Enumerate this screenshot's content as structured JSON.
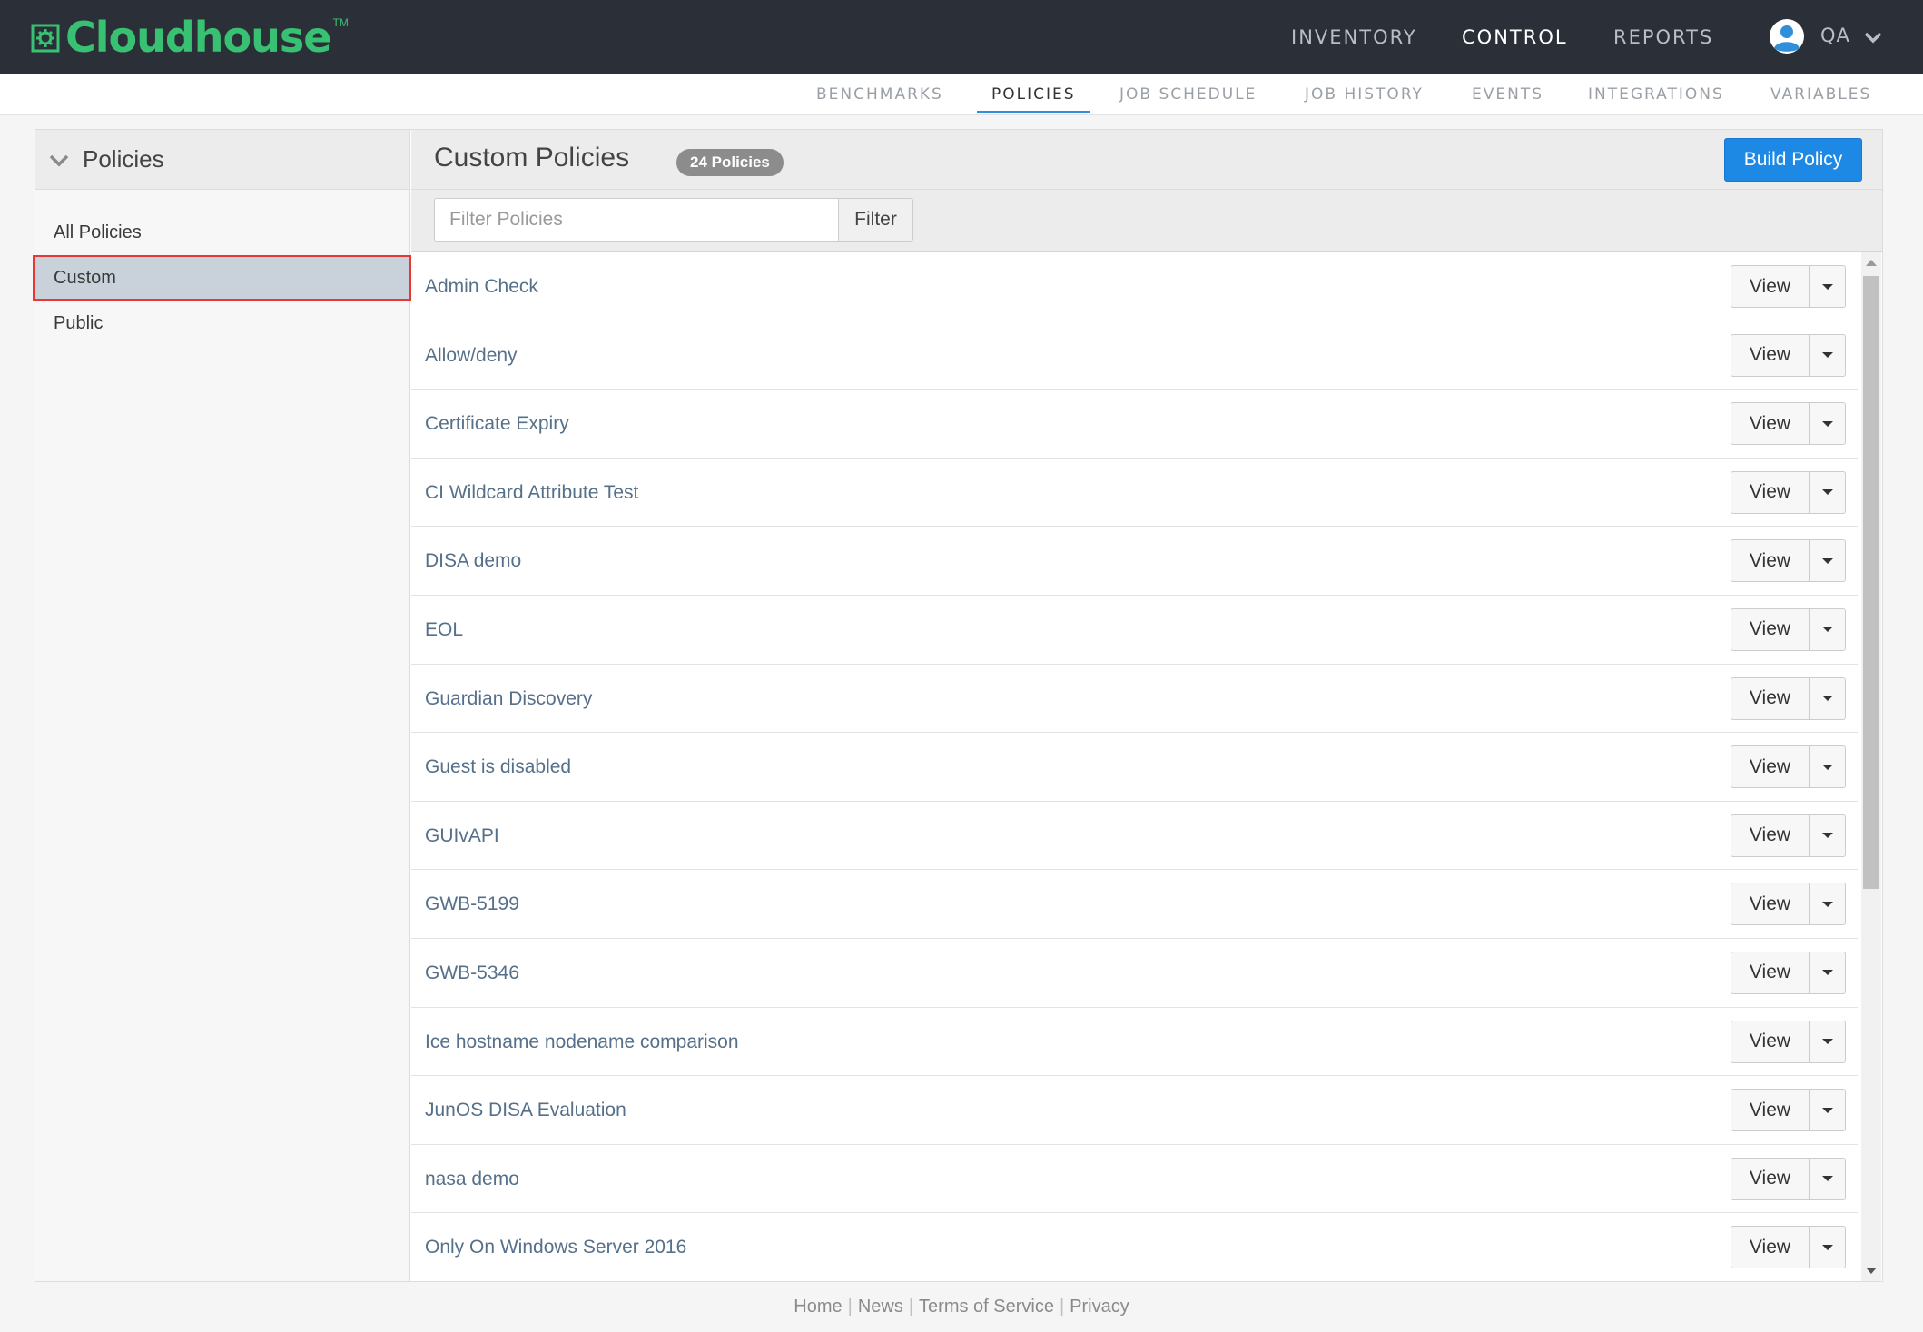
{
  "brand": {
    "name": "Cloudhouse",
    "trademark": "TM",
    "color": "#38c172"
  },
  "main_nav": {
    "items": [
      {
        "label": "INVENTORY",
        "active": false
      },
      {
        "label": "CONTROL",
        "active": true
      },
      {
        "label": "REPORTS",
        "active": false
      }
    ],
    "user": {
      "name": "QA",
      "icon": "user-avatar-icon"
    }
  },
  "sub_nav": {
    "items": [
      {
        "label": "BENCHMARKS",
        "active": false
      },
      {
        "label": "POLICIES",
        "active": true
      },
      {
        "label": "JOB SCHEDULE",
        "active": false
      },
      {
        "label": "JOB HISTORY",
        "active": false
      },
      {
        "label": "EVENTS",
        "active": false
      },
      {
        "label": "INTEGRATIONS",
        "active": false
      },
      {
        "label": "VARIABLES",
        "active": false
      }
    ],
    "accent_color": "#2f8fd8"
  },
  "sidebar": {
    "title": "Policies",
    "items": [
      {
        "label": "All Policies",
        "selected": false
      },
      {
        "label": "Custom",
        "selected": true
      },
      {
        "label": "Public",
        "selected": false
      }
    ]
  },
  "content": {
    "title": "Custom Policies",
    "count_badge": "24 Policies",
    "build_button": "Build Policy",
    "filter": {
      "placeholder": "Filter Policies",
      "value": "",
      "button": "Filter"
    },
    "row_button": "View",
    "policies": [
      "Admin Check",
      "Allow/deny",
      "Certificate Expiry",
      "CI Wildcard Attribute Test",
      "DISA demo",
      "EOL",
      "Guardian Discovery",
      "Guest is disabled",
      "GUIvAPI",
      "GWB-5199",
      "GWB-5346",
      "Ice hostname nodename comparison",
      "JunOS DISA Evaluation",
      "nasa demo",
      "Only On Windows Server 2016"
    ]
  },
  "footer": {
    "links": [
      "Home",
      "News",
      "Terms of Service",
      "Privacy"
    ],
    "separator": "|"
  }
}
